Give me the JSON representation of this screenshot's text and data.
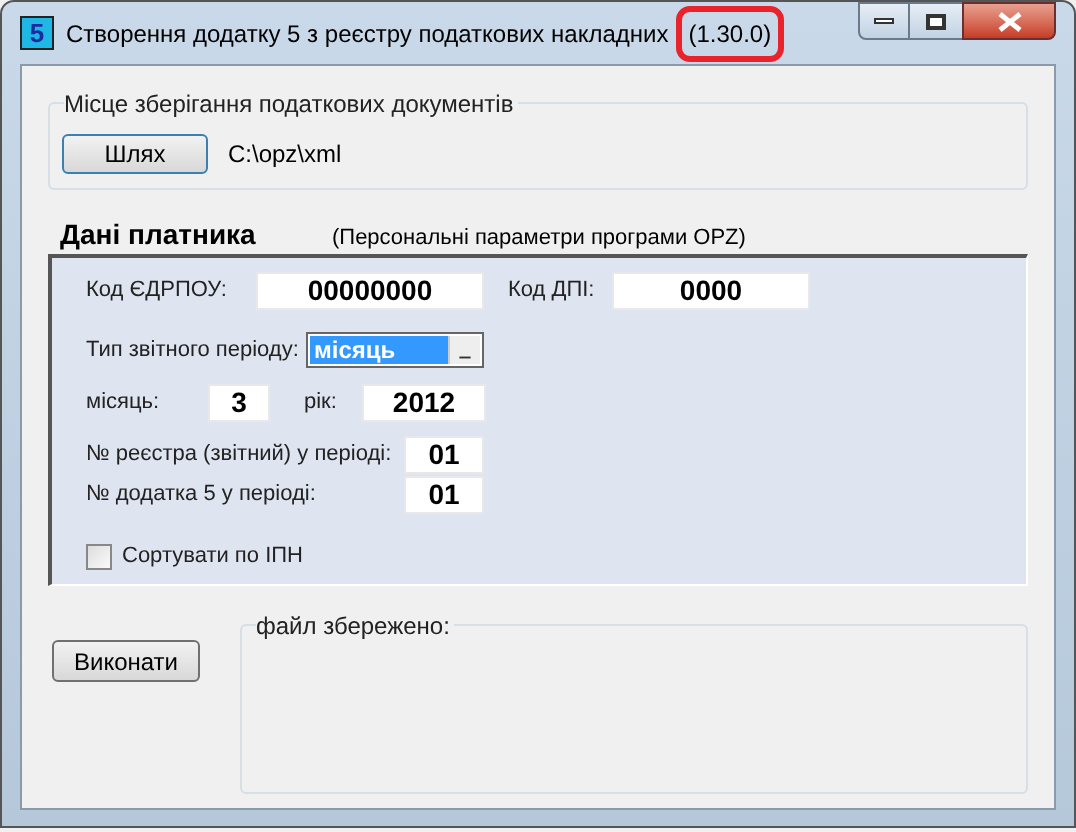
{
  "window": {
    "icon_text": "5",
    "title": "Створення додатку 5 з реєстру податкових накладних",
    "version": "(1.30.0)"
  },
  "storage": {
    "legend": "Місце зберігання податкових документів",
    "button": "Шлях",
    "path": "C:\\opz\\xml"
  },
  "payer": {
    "title": "Дані платника",
    "subtitle": "(Персональні параметри програми OPZ)",
    "edrpou_label": "Код ЄДРПОУ:",
    "edrpou": "00000000",
    "dpi_label": "Код ДПІ:",
    "dpi": "0000",
    "period_type_label": "Тип звітного періоду:",
    "period_type": "місяць",
    "month_label": "місяць:",
    "month": "3",
    "year_label": "рік:",
    "year": "2012",
    "register_label": "№ реєстра (звітний) у періоді:",
    "register": "01",
    "appendix_label": "№ додатка 5 у періоді:",
    "appendix": "01",
    "sort": {
      "label": "Сортувати по ІПН",
      "checked": false
    }
  },
  "run_button": "Виконати",
  "saved": {
    "legend": "файл збережено:"
  }
}
